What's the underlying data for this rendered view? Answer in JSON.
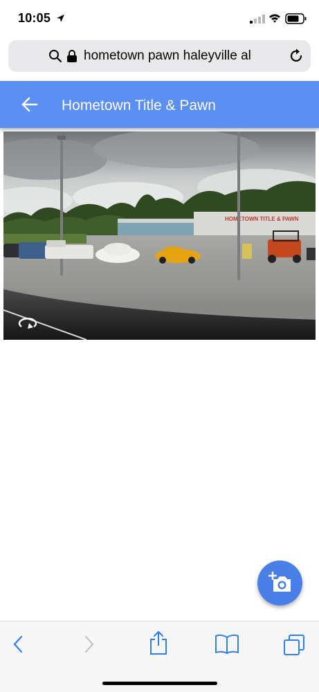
{
  "status_bar": {
    "time": "10:05",
    "icons": [
      "location-arrow-icon",
      "signal-icon",
      "wifi-icon",
      "battery-icon"
    ]
  },
  "browser": {
    "url_text": "hometown pawn haleyville al",
    "icons": [
      "search-icon",
      "lock-icon",
      "reload-icon"
    ]
  },
  "app_bar": {
    "title": "Hometown Title & Pawn",
    "color": "#5b8ff2",
    "back_icon": "arrow-left-icon"
  },
  "street_view": {
    "sign_text": "HOMETOWN TITLE & PAWN",
    "rotate_icon": "rotate-360-icon"
  },
  "fab": {
    "icon": "add-photo-icon",
    "color": "#4a7fe8"
  },
  "toolbar": {
    "items": [
      "back-icon",
      "forward-icon",
      "share-icon",
      "bookmarks-icon",
      "tabs-icon"
    ],
    "accent": "#2f7cf6"
  }
}
